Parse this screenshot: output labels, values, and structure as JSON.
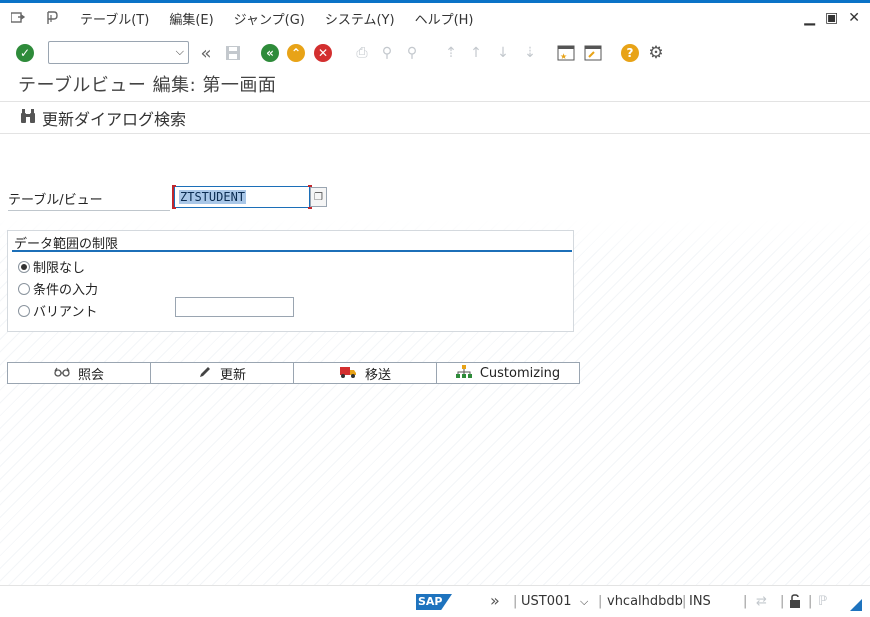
{
  "menu": {
    "items": [
      "テーブル(T)",
      "編集(E)",
      "ジャンプ(G)",
      "システム(Y)",
      "ヘルプ(H)"
    ]
  },
  "toolbar": {
    "command_value": ""
  },
  "screen": {
    "title": "テーブルビュー 編集: 第一画面",
    "app_button_label": "更新ダイアログ検索"
  },
  "form": {
    "field_label": "テーブル/ビュー",
    "field_value": "ZTSTUDENT",
    "group_title": "データ範囲の制限",
    "radios": [
      {
        "label": "制限なし",
        "selected": true
      },
      {
        "label": "条件の入力",
        "selected": false
      },
      {
        "label": "バリアント",
        "selected": false
      }
    ],
    "variant_value": ""
  },
  "buttons": {
    "display": "照会",
    "maintain": "更新",
    "transport": "移送",
    "customizing": "Customizing"
  },
  "status": {
    "sap_logo": "SAP",
    "user": "UST001",
    "server": "vhcalhdbdb",
    "mode": "INS"
  }
}
